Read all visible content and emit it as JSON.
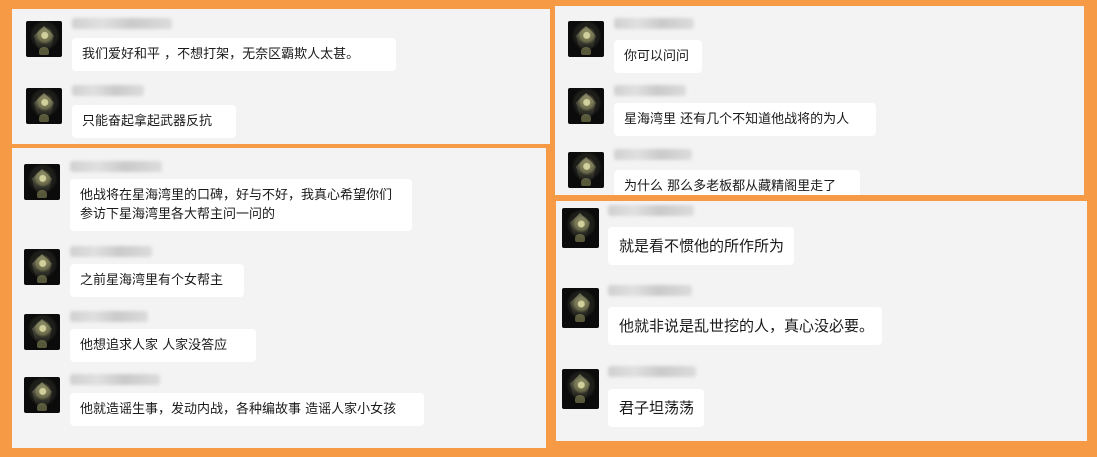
{
  "screenshot_panels": {
    "panel1": {
      "messages": [
        {
          "text": "我们爱好和平 ，不想打架，无奈区霸欺人太甚。"
        },
        {
          "text": "只能奋起拿起武器反抗"
        }
      ]
    },
    "panel2": {
      "messages": [
        {
          "text": "他战将在星海湾里的口碑，好与不好，我真心希望你们参访下星海湾里各大帮主问一问的"
        },
        {
          "text": "之前星海湾里有个女帮主"
        },
        {
          "text": "他想追求人家    人家没答应"
        },
        {
          "text": "他就造谣生事，发动内战，各种编故事 造谣人家小女孩"
        }
      ]
    },
    "panel3": {
      "messages": [
        {
          "text": "你可以问问"
        },
        {
          "text": "星海湾里 还有几个不知道他战将的为人"
        },
        {
          "text": "为什么 那么多老板都从藏精阁里走了"
        }
      ]
    },
    "panel4": {
      "messages": [
        {
          "text": "就是看不惯他的所作所为"
        },
        {
          "text": "他就非说是乱世挖的人，真心没必要。"
        },
        {
          "text": "君子坦荡荡"
        }
      ]
    }
  },
  "colors": {
    "background": "#f79a45",
    "panel": "#f3f3f3",
    "bubble": "#ffffff",
    "text": "#1a1a1a"
  },
  "icons": {
    "avatar": "user-avatar-icon"
  }
}
